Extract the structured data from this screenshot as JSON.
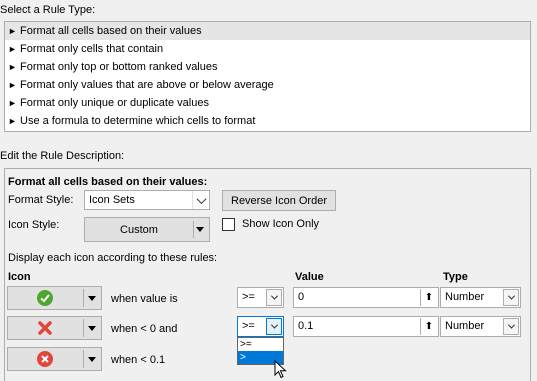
{
  "rule_type_section": {
    "label": "Select a Rule Type:",
    "items": [
      {
        "label": "Format all cells based on their values",
        "selected": true
      },
      {
        "label": "Format only cells that contain",
        "selected": false
      },
      {
        "label": "Format only top or bottom ranked values",
        "selected": false
      },
      {
        "label": "Format only values that are above or below average",
        "selected": false
      },
      {
        "label": "Format only unique or duplicate values",
        "selected": false
      },
      {
        "label": "Use a formula to determine which cells to format",
        "selected": false
      }
    ]
  },
  "description_section": {
    "label": "Edit the Rule Description:",
    "heading": "Format all cells based on their values:",
    "format_style_label": "Format Style:",
    "format_style_value": "Icon Sets",
    "reverse_button": "Reverse Icon Order",
    "icon_style_label": "Icon Style:",
    "icon_style_value": "Custom",
    "show_icon_only_label": "Show Icon Only",
    "show_icon_only_checked": false,
    "display_rules_label": "Display each icon according to these rules:",
    "columns": {
      "icon": "Icon",
      "value": "Value",
      "type": "Type"
    },
    "rows": [
      {
        "icon": "green-check-icon",
        "condition": "when value is",
        "operator": ">=",
        "value": "0",
        "type": "Number",
        "icon_color": "#4ea72e"
      },
      {
        "icon": "red-x-icon",
        "condition": "when < 0 and",
        "operator": ">=",
        "value": "0.1",
        "type": "Number",
        "icon_color": "#e0473a"
      },
      {
        "icon": "red-circle-x-icon",
        "condition": "when < 0.1",
        "icon_color": "#e0473a"
      }
    ],
    "operator_dropdown_options": [
      ">=",
      ">"
    ],
    "operator_dropdown_selected": ">"
  }
}
